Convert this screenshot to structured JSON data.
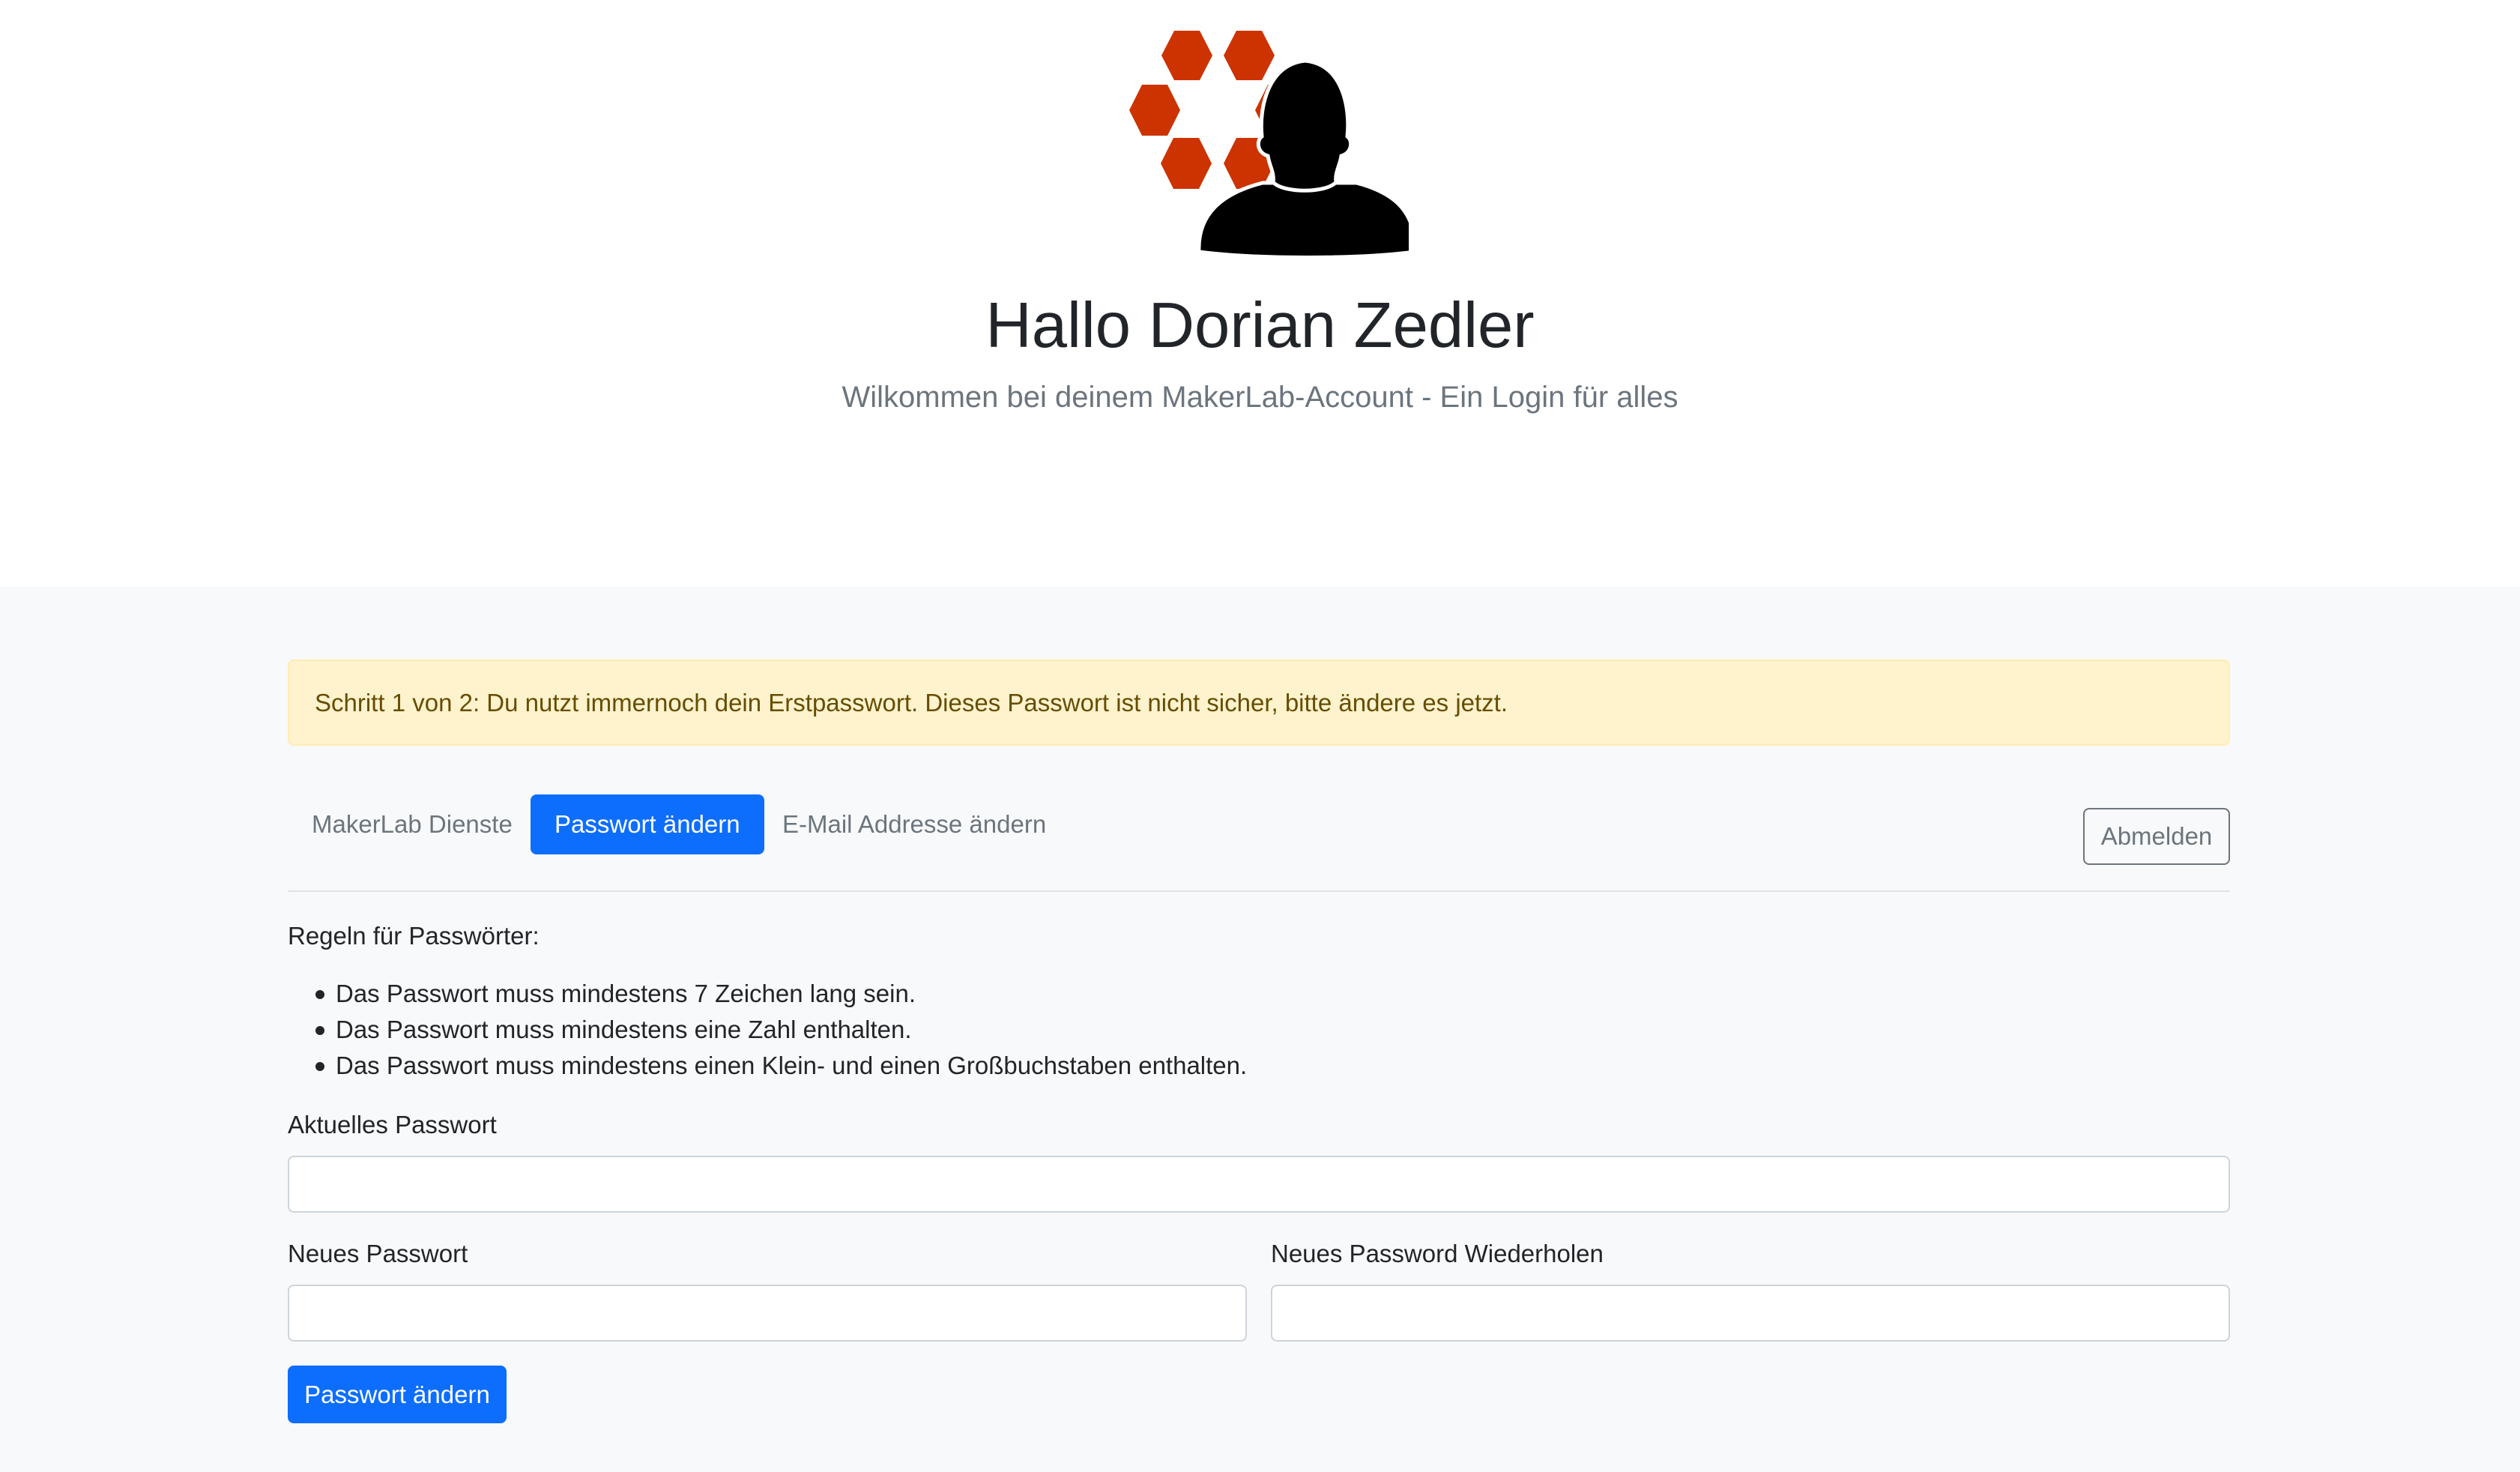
{
  "header": {
    "logo_icon": "makerlab-user-logo-icon",
    "title": "Hallo Dorian Zedler",
    "subtitle": "Wilkommen bei deinem MakerLab-Account - Ein Login für alles"
  },
  "alert": {
    "text": "Schritt 1 von 2: Du nutzt immernoch dein Erstpasswort. Dieses Passwort ist nicht sicher, bitte ändere es jetzt."
  },
  "nav": {
    "items": [
      {
        "label": "MakerLab Dienste",
        "active": false
      },
      {
        "label": "Passwort ändern",
        "active": true
      },
      {
        "label": "E-Mail Addresse ändern",
        "active": false
      }
    ],
    "logout_label": "Abmelden"
  },
  "rules": {
    "title": "Regeln für Passwörter:",
    "items": [
      "Das Passwort muss mindestens 7 Zeichen lang sein.",
      "Das Passwort muss mindestens eine Zahl enthalten.",
      "Das Passwort muss mindestens einen Klein- und einen Großbuchstaben enthalten."
    ]
  },
  "form": {
    "current_label": "Aktuelles Passwort",
    "current_value": "",
    "new_label": "Neues Passwort",
    "new_value": "",
    "repeat_label": "Neues Password Wiederholen",
    "repeat_value": "",
    "submit_label": "Passwort ändern"
  },
  "colors": {
    "primary": "#0d6efd",
    "alert_bg": "#fff3cd",
    "alert_text": "#664d03",
    "hexagon": "#cc3300",
    "muted": "#6c757d"
  }
}
